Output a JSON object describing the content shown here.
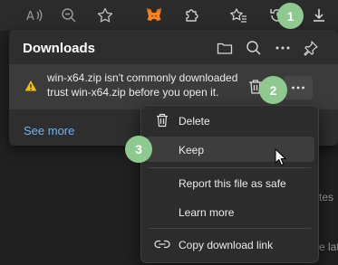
{
  "toolbar": {
    "icons": [
      "read-aloud-icon",
      "zoom-out-icon",
      "favorite-star-icon",
      "metamask-fox-icon",
      "extensions-icon",
      "favorites-icon",
      "history-icon",
      "downloads-icon"
    ]
  },
  "callouts": [
    "1",
    "2",
    "3"
  ],
  "downloads_panel": {
    "title": "Downloads",
    "item": {
      "message_line1": "win-x64.zip isn't commonly downloaded.",
      "message_line2": "trust win-x64.zip before you open it."
    },
    "see_more_label": "See more"
  },
  "context_menu": {
    "items": [
      {
        "label": "Delete",
        "icon": "trash-icon"
      },
      {
        "label": "Keep",
        "icon": ""
      },
      {
        "label": "Report this file as safe",
        "icon": ""
      },
      {
        "label": "Learn more",
        "icon": ""
      },
      {
        "label": "Copy download link",
        "icon": "link-icon"
      }
    ]
  },
  "background_page": {
    "peek_1": "tes",
    "peek_2": "e late"
  },
  "colors": {
    "callout": "#8ec98f",
    "link": "#7ab0e6",
    "warning": "#f2c100"
  }
}
